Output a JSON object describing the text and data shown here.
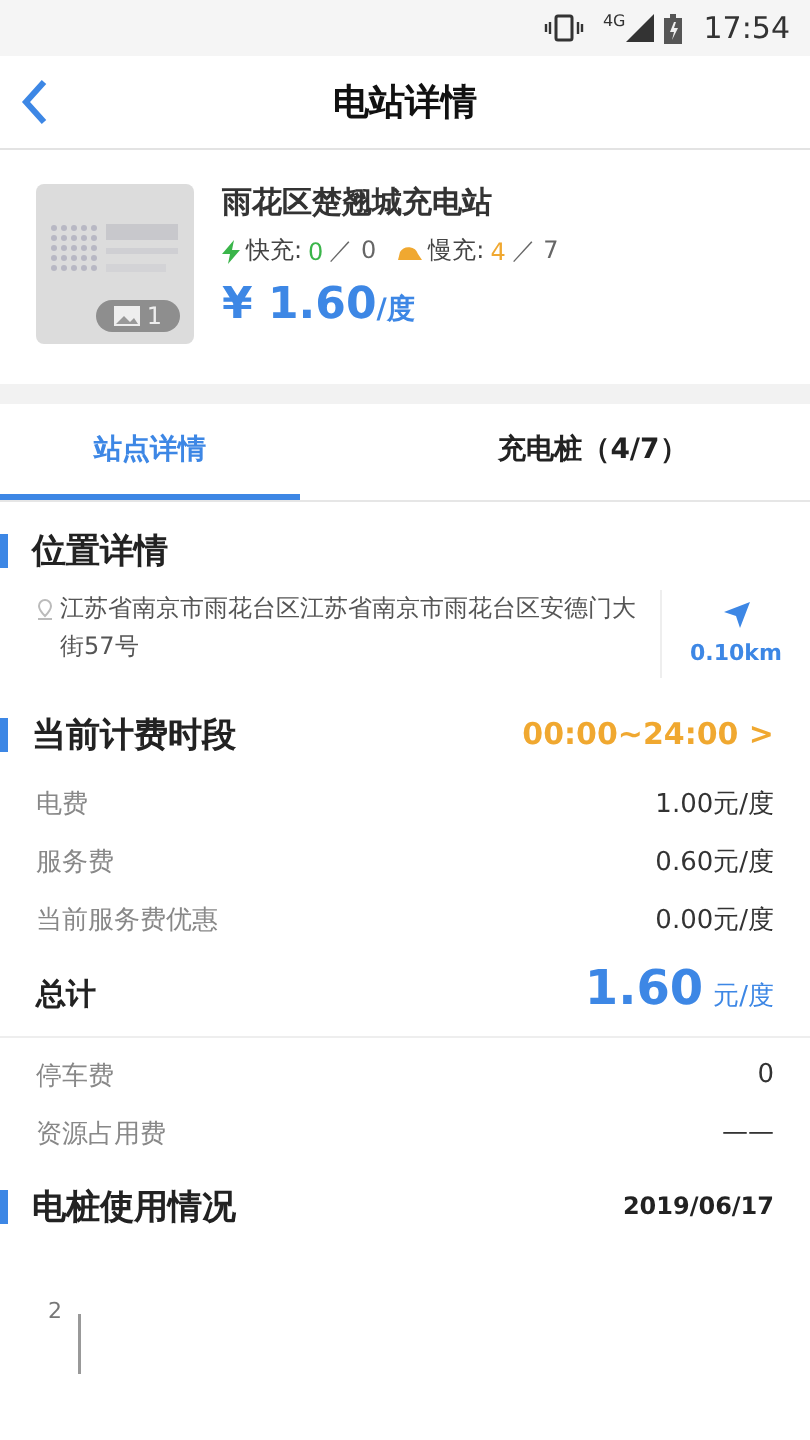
{
  "status_bar": {
    "network": "4G",
    "time": "17:54"
  },
  "header": {
    "title": "电站详情"
  },
  "station": {
    "name": "雨花区楚翘城充电站",
    "photo_count": "1",
    "fast_label": "快充:",
    "fast_free": "0",
    "fast_total": "／ 0",
    "slow_label": "慢充:",
    "slow_free": "4",
    "slow_total": "／ 7",
    "price": "¥ 1.60",
    "price_unit": "/度"
  },
  "tabs": [
    {
      "label": "站点详情",
      "selected": true
    },
    {
      "label": "充电桩（4/7）",
      "selected": false
    }
  ],
  "location": {
    "title": "位置详情",
    "address": "江苏省南京市雨花台区江苏省南京市雨花台区安德门大街57号",
    "distance": "0.10km"
  },
  "billing": {
    "title": "当前计费时段",
    "period": "00:00~24:00 >",
    "rows": [
      {
        "label": "电费",
        "value": "1.00元/度"
      },
      {
        "label": "服务费",
        "value": "0.60元/度"
      },
      {
        "label": "当前服务费优惠",
        "value": "0.00元/度"
      }
    ],
    "total_label": "总计",
    "total_value": "1.60",
    "total_unit": "元/度"
  },
  "extra_fees": [
    {
      "label": "停车费",
      "value": "0"
    },
    {
      "label": "资源占用费",
      "value": "——"
    }
  ],
  "usage": {
    "title": "电桩使用情况",
    "date": "2019/06/17",
    "y_tick": "2"
  }
}
